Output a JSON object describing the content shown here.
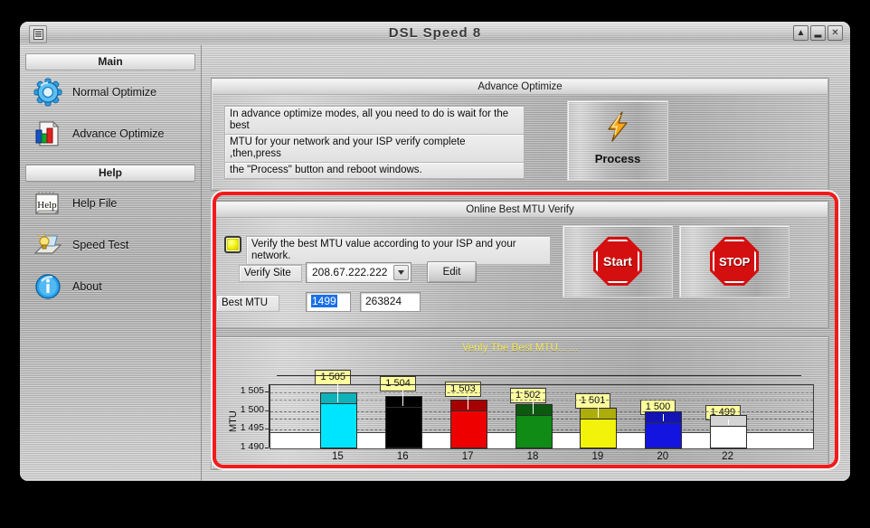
{
  "window": {
    "title": "DSL  Speed 8",
    "sysmenu_icon": "document-icon",
    "controls": [
      {
        "name": "restore-button",
        "glyph": "▲"
      },
      {
        "name": "minimize-button",
        "glyph": "▂"
      },
      {
        "name": "close-button",
        "glyph": "✕"
      }
    ]
  },
  "sidebar": {
    "groups": [
      {
        "header": "Main",
        "items": [
          {
            "label": "Normal Optimize",
            "icon": "gear-icon"
          },
          {
            "label": "Advance Optimize",
            "icon": "charts-document-icon"
          }
        ]
      },
      {
        "header": "Help",
        "items": [
          {
            "label": "Help File",
            "icon": "help-notepad-icon"
          },
          {
            "label": "Speed Test",
            "icon": "speed-test-icon"
          },
          {
            "label": "About",
            "icon": "info-icon"
          }
        ]
      }
    ]
  },
  "advance_panel": {
    "title": "Advance Optimize",
    "lines": [
      "In advance optimize modes, all you need to do is wait for the best",
      "MTU for your network and your ISP verify complete ,then,press",
      "the \"Process\" button and reboot windows."
    ],
    "process_button": {
      "label": "Process",
      "icon": "lightning-bolt-icon"
    }
  },
  "mtu_panel": {
    "title": "Online Best MTU Verify",
    "led": {
      "name": "status-led",
      "color": "#f2f20a"
    },
    "description": "Verify the best MTU value according to your ISP and your network.",
    "verify_site": {
      "label": "Verify Site",
      "value": "208.67.222.222",
      "edit_label": "Edit"
    },
    "best_mtu": {
      "label": "Best MTU",
      "value": "1499",
      "value_selected": true,
      "counter": "263824"
    },
    "start_button": {
      "label": "Start"
    },
    "stop_button": {
      "label": "STOP"
    }
  },
  "chart_data": {
    "type": "bar",
    "title": "Verify The Best MTU... ...",
    "xlabel": "",
    "ylabel": "MTU",
    "categories": [
      "15",
      "16",
      "17",
      "18",
      "19",
      "20",
      "22"
    ],
    "values": [
      1505,
      1504,
      1503,
      1502,
      1501,
      1500,
      1499
    ],
    "data_labels": [
      "1 505",
      "1 504",
      "1 503",
      "1 502",
      "1 501",
      "1 500",
      "1 499"
    ],
    "yticks": [
      "1 505",
      "1 500",
      "1 495",
      "1 490"
    ],
    "ytick_values": [
      1505,
      1500,
      1495,
      1490
    ],
    "ylim": [
      1490,
      1507
    ],
    "grid": true,
    "legend": false,
    "colors": [
      "#00e5ff",
      "#000000",
      "#ee0000",
      "#0f8b16",
      "#f2f20a",
      "#1414e0",
      "#ffffff"
    ],
    "cap_colors": [
      "#0fb2b8",
      "#000000",
      "#a60000",
      "#0b5a0e",
      "#adad0b",
      "#1414b5",
      "#d4d4d4"
    ]
  },
  "annotation": {
    "highlight_color": "#f21b1b"
  }
}
